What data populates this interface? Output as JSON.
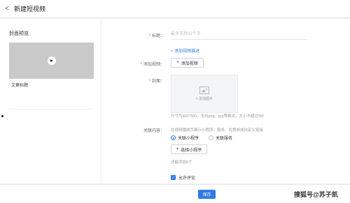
{
  "header": {
    "back_icon": "<",
    "title": "新建短视频"
  },
  "sidebar": {
    "title": "封面预览",
    "card": {
      "thumbnail_icon": "play-icon",
      "title": "文章标题"
    }
  },
  "form": {
    "title_label": "标题：",
    "title_placeholder": "最多支持32个字",
    "add_desc_link": "+ 添加视频描述",
    "add_video_label": "添加视频：",
    "add_video_button": "添加视频",
    "cover_label": "封面：",
    "upload_text": "+ 添加图片",
    "cover_hint": "尺寸为900*500，支持png、jpg等格式，大小不超过5M",
    "related_label": "关联内容：",
    "related_hint": "在视频播放页展示小程序、服务、优惠券或自定义链接",
    "radio_options": [
      {
        "label": "关联小程序",
        "selected": true
      },
      {
        "label": "关联服务",
        "selected": false
      }
    ],
    "select_button": "选择小程序",
    "remaining_hint": "还能添加6个",
    "allow_comment": {
      "label": "允许评论",
      "checked": true
    }
  },
  "footer": {
    "save_label": "保存"
  },
  "watermark": "搜狐号@苏子凯",
  "colors": {
    "accent": "#2f7be5",
    "required": "#e5484d"
  }
}
